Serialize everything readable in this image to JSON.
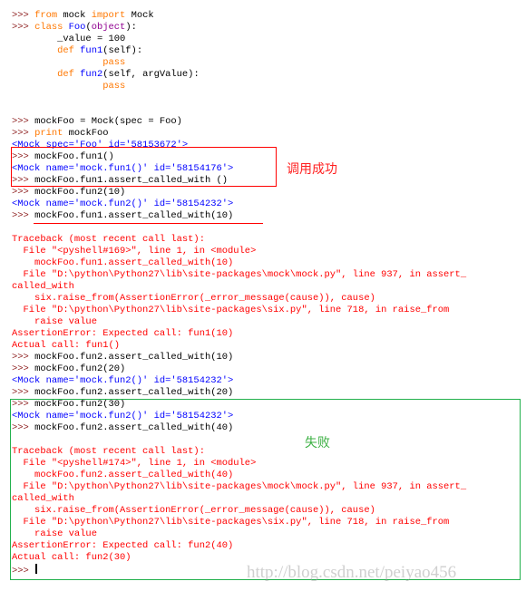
{
  "colors": {
    "prompt": "#8b1a1a",
    "keyword": "#ff7700",
    "definition": "#0000ff",
    "builtin": "#900090",
    "output": "#0000ff",
    "error": "#ff0000",
    "annotation_success": "#ff2020",
    "annotation_fail": "#3cb043",
    "box_red": "#ff0000",
    "box_green": "#22b14c"
  },
  "annotations": {
    "success": "调用成功",
    "fail": "失败"
  },
  "watermark": "http://blog.csdn.net/peiyao456",
  "lines": [
    [
      {
        "t": ">>> ",
        "c": "p"
      },
      {
        "t": "from",
        "c": "k"
      },
      {
        "t": " mock ",
        "c": "n"
      },
      {
        "t": "import",
        "c": "k"
      },
      {
        "t": " Mock",
        "c": "n"
      }
    ],
    [
      {
        "t": ">>> ",
        "c": "p"
      },
      {
        "t": "class",
        "c": "k"
      },
      {
        "t": " ",
        "c": "n"
      },
      {
        "t": "Foo",
        "c": "d"
      },
      {
        "t": "(",
        "c": "n"
      },
      {
        "t": "object",
        "c": "b"
      },
      {
        "t": "):",
        "c": "n"
      }
    ],
    [
      {
        "t": "        _value = 100",
        "c": "n"
      }
    ],
    [
      {
        "t": "        ",
        "c": "n"
      },
      {
        "t": "def",
        "c": "k"
      },
      {
        "t": " ",
        "c": "n"
      },
      {
        "t": "fun1",
        "c": "d"
      },
      {
        "t": "(self):",
        "c": "n"
      }
    ],
    [
      {
        "t": "                ",
        "c": "n"
      },
      {
        "t": "pass",
        "c": "k"
      }
    ],
    [
      {
        "t": "        ",
        "c": "n"
      },
      {
        "t": "def",
        "c": "k"
      },
      {
        "t": " ",
        "c": "n"
      },
      {
        "t": "fun2",
        "c": "d"
      },
      {
        "t": "(self, argValue):",
        "c": "n"
      }
    ],
    [
      {
        "t": "                ",
        "c": "n"
      },
      {
        "t": "pass",
        "c": "k"
      }
    ],
    [],
    [],
    [
      {
        "t": ">>> ",
        "c": "p"
      },
      {
        "t": "mockFoo = Mock(spec = Foo)",
        "c": "n"
      }
    ],
    [
      {
        "t": ">>> ",
        "c": "p"
      },
      {
        "t": "print",
        "c": "k"
      },
      {
        "t": " mockFoo",
        "c": "n"
      }
    ],
    [
      {
        "t": "<Mock spec='Foo' id='58153672'>",
        "c": "o"
      }
    ],
    [
      {
        "t": ">>> ",
        "c": "p"
      },
      {
        "t": "mockFoo.fun1()",
        "c": "n"
      }
    ],
    [
      {
        "t": "<Mock name='mock.fun1()' id='58154176'>",
        "c": "o"
      }
    ],
    [
      {
        "t": ">>> ",
        "c": "p"
      },
      {
        "t": "mockFoo.fun1.assert_called_with ()",
        "c": "n"
      }
    ],
    [
      {
        "t": ">>> ",
        "c": "p"
      },
      {
        "t": "mockFoo.fun2(10)",
        "c": "n"
      }
    ],
    [
      {
        "t": "<Mock name='mock.fun2()' id='58154232'>",
        "c": "o"
      }
    ],
    [
      {
        "t": ">>> ",
        "c": "p"
      },
      {
        "t": "mockFoo.fun1.assert_called_with(10)",
        "c": "n"
      }
    ],
    [],
    [
      {
        "t": "Traceback (most recent call last):",
        "c": "e"
      }
    ],
    [
      {
        "t": "  File \"<pyshell#169>\", line 1, in <module>",
        "c": "e"
      }
    ],
    [
      {
        "t": "    mockFoo.fun1.assert_called_with(10)",
        "c": "e"
      }
    ],
    [
      {
        "t": "  File \"D:\\python\\Python27\\lib\\site-packages\\mock\\mock.py\", line 937, in assert_",
        "c": "e"
      }
    ],
    [
      {
        "t": "called_with",
        "c": "e"
      }
    ],
    [
      {
        "t": "    six.raise_from(AssertionError(_error_message(cause)), cause)",
        "c": "e"
      }
    ],
    [
      {
        "t": "  File \"D:\\python\\Python27\\lib\\site-packages\\six.py\", line 718, in raise_from",
        "c": "e"
      }
    ],
    [
      {
        "t": "    raise value",
        "c": "e"
      }
    ],
    [
      {
        "t": "AssertionError: Expected call: fun1(10)",
        "c": "e"
      }
    ],
    [
      {
        "t": "Actual call: fun1()",
        "c": "e"
      }
    ],
    [
      {
        "t": ">>> ",
        "c": "p"
      },
      {
        "t": "mockFoo.fun2.assert_called_with(10)",
        "c": "n"
      }
    ],
    [
      {
        "t": ">>> ",
        "c": "p"
      },
      {
        "t": "mockFoo.fun2(20)",
        "c": "n"
      }
    ],
    [
      {
        "t": "<Mock name='mock.fun2()' id='58154232'>",
        "c": "o"
      }
    ],
    [
      {
        "t": ">>> ",
        "c": "p"
      },
      {
        "t": "mockFoo.fun2.assert_called_with(20)",
        "c": "n"
      }
    ],
    [
      {
        "t": ">>> ",
        "c": "p"
      },
      {
        "t": "mockFoo.fun2(30)",
        "c": "n"
      }
    ],
    [
      {
        "t": "<Mock name='mock.fun2()' id='58154232'>",
        "c": "o"
      }
    ],
    [
      {
        "t": ">>> ",
        "c": "p"
      },
      {
        "t": "mockFoo.fun2.assert_called_with(40)",
        "c": "n"
      }
    ],
    [],
    [
      {
        "t": "Traceback (most recent call last):",
        "c": "e"
      }
    ],
    [
      {
        "t": "  File \"<pyshell#174>\", line 1, in <module>",
        "c": "e"
      }
    ],
    [
      {
        "t": "    mockFoo.fun2.assert_called_with(40)",
        "c": "e"
      }
    ],
    [
      {
        "t": "  File \"D:\\python\\Python27\\lib\\site-packages\\mock\\mock.py\", line 937, in assert_",
        "c": "e"
      }
    ],
    [
      {
        "t": "called_with",
        "c": "e"
      }
    ],
    [
      {
        "t": "    six.raise_from(AssertionError(_error_message(cause)), cause)",
        "c": "e"
      }
    ],
    [
      {
        "t": "  File \"D:\\python\\Python27\\lib\\site-packages\\six.py\", line 718, in raise_from",
        "c": "e"
      }
    ],
    [
      {
        "t": "    raise value",
        "c": "e"
      }
    ],
    [
      {
        "t": "AssertionError: Expected call: fun2(40)",
        "c": "e"
      }
    ],
    [
      {
        "t": "Actual call: fun2(30)",
        "c": "e"
      }
    ],
    [
      {
        "t": ">>> ",
        "c": "p"
      }
    ]
  ]
}
